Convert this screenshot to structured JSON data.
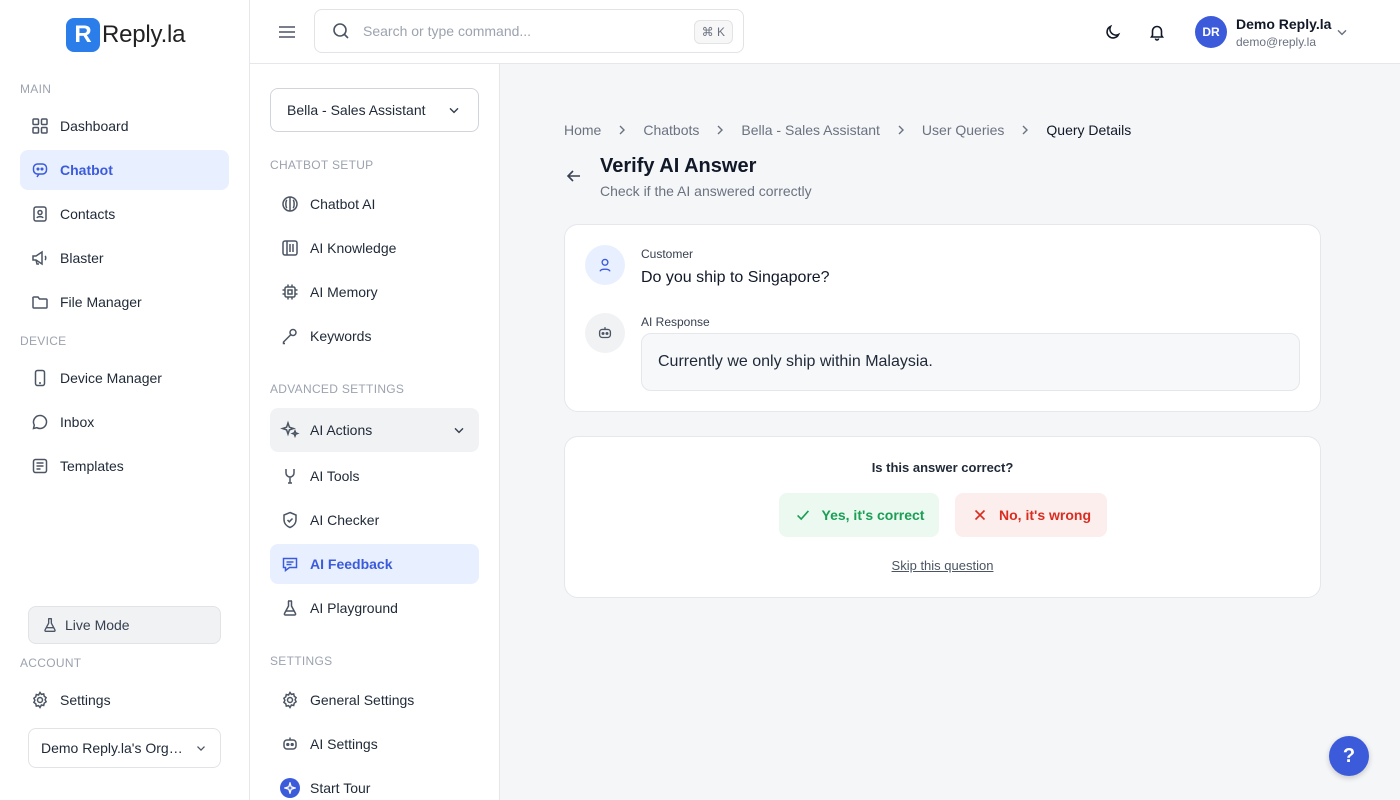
{
  "brand": {
    "logo_letter": "R",
    "name": "Reply.la",
    "accent": "#3b5bdb",
    "logo_color": "#2b7de9"
  },
  "sidebar": {
    "section_main": "MAIN",
    "section_device": "DEVICE",
    "section_account": "ACCOUNT",
    "items": {
      "dashboard": "Dashboard",
      "chatbot": "Chatbot",
      "contacts": "Contacts",
      "blaster": "Blaster",
      "file_manager": "File Manager",
      "device_manager": "Device Manager",
      "inbox": "Inbox",
      "templates": "Templates",
      "settings": "Settings"
    },
    "live_mode": "Live Mode",
    "org_select": "Demo Reply.la's Organization"
  },
  "topbar": {
    "search_placeholder": "Search or type command...",
    "shortcut": "⌘ K",
    "user": {
      "initials": "DR",
      "name": "Demo Reply.la",
      "email": "demo@reply.la"
    }
  },
  "subsidebar": {
    "bot_select": "Bella - Sales Assistant",
    "section_setup": "CHATBOT SETUP",
    "section_advanced": "ADVANCED SETTINGS",
    "section_settings": "SETTINGS",
    "items": {
      "chatbot_ai": "Chatbot AI",
      "ai_knowledge": "AI Knowledge",
      "ai_memory": "AI Memory",
      "keywords": "Keywords",
      "ai_actions": "AI Actions",
      "ai_tools": "AI Tools",
      "ai_checker": "AI Checker",
      "ai_feedback": "AI Feedback",
      "ai_playground": "AI Playground",
      "general_settings": "General Settings",
      "ai_settings": "AI Settings",
      "start_tour": "Start Tour"
    }
  },
  "main": {
    "breadcrumb": [
      "Home",
      "Chatbots",
      "Bella - Sales Assistant",
      "User Queries",
      "Query Details"
    ],
    "title": "Verify AI Answer",
    "subtitle": "Check if the AI answered correctly",
    "customer_label": "Customer",
    "customer_question": "Do you ship to Singapore?",
    "ai_label": "AI Response",
    "ai_answer": "Currently we only ship within Malaysia.",
    "verify_question": "Is this answer correct?",
    "yes_label": "Yes, it's correct",
    "no_label": "No, it's wrong",
    "skip_label": "Skip this question"
  },
  "help": {
    "label": "?"
  }
}
